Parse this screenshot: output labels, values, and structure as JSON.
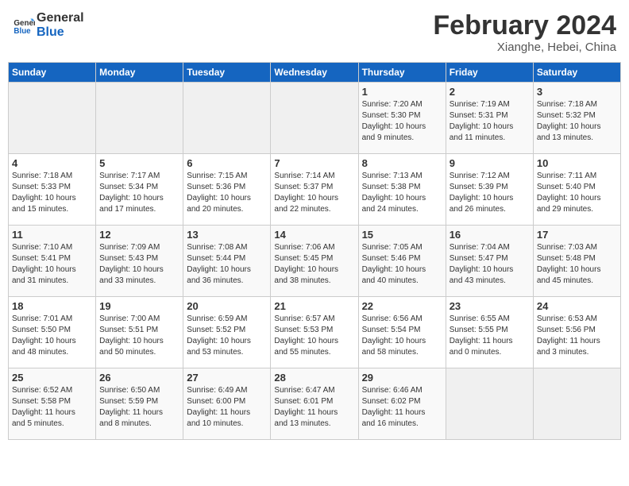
{
  "header": {
    "logo_line1": "General",
    "logo_line2": "Blue",
    "month_title": "February 2024",
    "location": "Xianghe, Hebei, China"
  },
  "weekdays": [
    "Sunday",
    "Monday",
    "Tuesday",
    "Wednesday",
    "Thursday",
    "Friday",
    "Saturday"
  ],
  "weeks": [
    [
      {
        "day": "",
        "info": ""
      },
      {
        "day": "",
        "info": ""
      },
      {
        "day": "",
        "info": ""
      },
      {
        "day": "",
        "info": ""
      },
      {
        "day": "1",
        "info": "Sunrise: 7:20 AM\nSunset: 5:30 PM\nDaylight: 10 hours\nand 9 minutes."
      },
      {
        "day": "2",
        "info": "Sunrise: 7:19 AM\nSunset: 5:31 PM\nDaylight: 10 hours\nand 11 minutes."
      },
      {
        "day": "3",
        "info": "Sunrise: 7:18 AM\nSunset: 5:32 PM\nDaylight: 10 hours\nand 13 minutes."
      }
    ],
    [
      {
        "day": "4",
        "info": "Sunrise: 7:18 AM\nSunset: 5:33 PM\nDaylight: 10 hours\nand 15 minutes."
      },
      {
        "day": "5",
        "info": "Sunrise: 7:17 AM\nSunset: 5:34 PM\nDaylight: 10 hours\nand 17 minutes."
      },
      {
        "day": "6",
        "info": "Sunrise: 7:15 AM\nSunset: 5:36 PM\nDaylight: 10 hours\nand 20 minutes."
      },
      {
        "day": "7",
        "info": "Sunrise: 7:14 AM\nSunset: 5:37 PM\nDaylight: 10 hours\nand 22 minutes."
      },
      {
        "day": "8",
        "info": "Sunrise: 7:13 AM\nSunset: 5:38 PM\nDaylight: 10 hours\nand 24 minutes."
      },
      {
        "day": "9",
        "info": "Sunrise: 7:12 AM\nSunset: 5:39 PM\nDaylight: 10 hours\nand 26 minutes."
      },
      {
        "day": "10",
        "info": "Sunrise: 7:11 AM\nSunset: 5:40 PM\nDaylight: 10 hours\nand 29 minutes."
      }
    ],
    [
      {
        "day": "11",
        "info": "Sunrise: 7:10 AM\nSunset: 5:41 PM\nDaylight: 10 hours\nand 31 minutes."
      },
      {
        "day": "12",
        "info": "Sunrise: 7:09 AM\nSunset: 5:43 PM\nDaylight: 10 hours\nand 33 minutes."
      },
      {
        "day": "13",
        "info": "Sunrise: 7:08 AM\nSunset: 5:44 PM\nDaylight: 10 hours\nand 36 minutes."
      },
      {
        "day": "14",
        "info": "Sunrise: 7:06 AM\nSunset: 5:45 PM\nDaylight: 10 hours\nand 38 minutes."
      },
      {
        "day": "15",
        "info": "Sunrise: 7:05 AM\nSunset: 5:46 PM\nDaylight: 10 hours\nand 40 minutes."
      },
      {
        "day": "16",
        "info": "Sunrise: 7:04 AM\nSunset: 5:47 PM\nDaylight: 10 hours\nand 43 minutes."
      },
      {
        "day": "17",
        "info": "Sunrise: 7:03 AM\nSunset: 5:48 PM\nDaylight: 10 hours\nand 45 minutes."
      }
    ],
    [
      {
        "day": "18",
        "info": "Sunrise: 7:01 AM\nSunset: 5:50 PM\nDaylight: 10 hours\nand 48 minutes."
      },
      {
        "day": "19",
        "info": "Sunrise: 7:00 AM\nSunset: 5:51 PM\nDaylight: 10 hours\nand 50 minutes."
      },
      {
        "day": "20",
        "info": "Sunrise: 6:59 AM\nSunset: 5:52 PM\nDaylight: 10 hours\nand 53 minutes."
      },
      {
        "day": "21",
        "info": "Sunrise: 6:57 AM\nSunset: 5:53 PM\nDaylight: 10 hours\nand 55 minutes."
      },
      {
        "day": "22",
        "info": "Sunrise: 6:56 AM\nSunset: 5:54 PM\nDaylight: 10 hours\nand 58 minutes."
      },
      {
        "day": "23",
        "info": "Sunrise: 6:55 AM\nSunset: 5:55 PM\nDaylight: 11 hours\nand 0 minutes."
      },
      {
        "day": "24",
        "info": "Sunrise: 6:53 AM\nSunset: 5:56 PM\nDaylight: 11 hours\nand 3 minutes."
      }
    ],
    [
      {
        "day": "25",
        "info": "Sunrise: 6:52 AM\nSunset: 5:58 PM\nDaylight: 11 hours\nand 5 minutes."
      },
      {
        "day": "26",
        "info": "Sunrise: 6:50 AM\nSunset: 5:59 PM\nDaylight: 11 hours\nand 8 minutes."
      },
      {
        "day": "27",
        "info": "Sunrise: 6:49 AM\nSunset: 6:00 PM\nDaylight: 11 hours\nand 10 minutes."
      },
      {
        "day": "28",
        "info": "Sunrise: 6:47 AM\nSunset: 6:01 PM\nDaylight: 11 hours\nand 13 minutes."
      },
      {
        "day": "29",
        "info": "Sunrise: 6:46 AM\nSunset: 6:02 PM\nDaylight: 11 hours\nand 16 minutes."
      },
      {
        "day": "",
        "info": ""
      },
      {
        "day": "",
        "info": ""
      }
    ]
  ]
}
